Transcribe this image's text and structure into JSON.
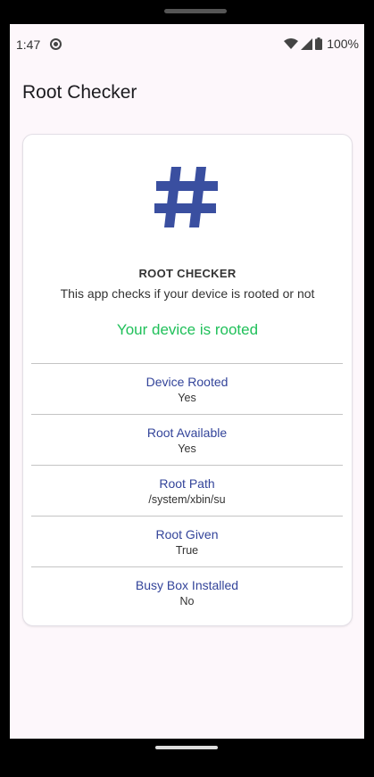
{
  "status_bar": {
    "time": "1:47",
    "app_icon": "app-notification-icon",
    "wifi_icon": "wifi-icon",
    "signal_icon": "signal-icon",
    "battery_icon": "battery-icon",
    "battery": "100%"
  },
  "app_bar": {
    "title": "Root Checker"
  },
  "card": {
    "icon": "hash-icon",
    "icon_color": "#3a4fa0",
    "heading": "ROOT CHECKER",
    "description": "This app checks if your device is rooted or not",
    "status_message": "Your device is rooted",
    "status_color": "#20c05a",
    "rows": [
      {
        "label": "Device Rooted",
        "value": "Yes"
      },
      {
        "label": "Root Available",
        "value": "Yes"
      },
      {
        "label": "Root Path",
        "value": "/system/xbin/su"
      },
      {
        "label": "Root Given",
        "value": "True"
      },
      {
        "label": "Busy Box Installed",
        "value": "No"
      }
    ]
  },
  "colors": {
    "label_accent": "#33449a",
    "screen_bg": "#fdf7fb"
  }
}
